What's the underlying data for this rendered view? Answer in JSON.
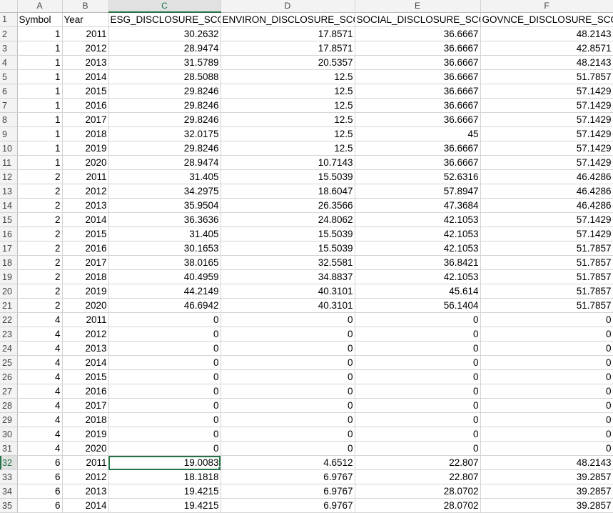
{
  "columns": [
    "A",
    "B",
    "C",
    "D",
    "E",
    "F"
  ],
  "selected_column": "C",
  "selected_row": 32,
  "active_cell": "C32",
  "header_row": [
    "Symbol",
    "Year",
    "ESG_DISCLOSURE_SCORE",
    "ENVIRON_DISCLOSURE_SCORE",
    "SOCIAL_DISCLOSURE_SCORE",
    "GOVNCE_DISCLOSURE_SCORE"
  ],
  "rows": [
    [
      "1",
      "2011",
      "30.2632",
      "17.8571",
      "36.6667",
      "48.2143"
    ],
    [
      "1",
      "2012",
      "28.9474",
      "17.8571",
      "36.6667",
      "42.8571"
    ],
    [
      "1",
      "2013",
      "31.5789",
      "20.5357",
      "36.6667",
      "48.2143"
    ],
    [
      "1",
      "2014",
      "28.5088",
      "12.5",
      "36.6667",
      "51.7857"
    ],
    [
      "1",
      "2015",
      "29.8246",
      "12.5",
      "36.6667",
      "57.1429"
    ],
    [
      "1",
      "2016",
      "29.8246",
      "12.5",
      "36.6667",
      "57.1429"
    ],
    [
      "1",
      "2017",
      "29.8246",
      "12.5",
      "36.6667",
      "57.1429"
    ],
    [
      "1",
      "2018",
      "32.0175",
      "12.5",
      "45",
      "57.1429"
    ],
    [
      "1",
      "2019",
      "29.8246",
      "12.5",
      "36.6667",
      "57.1429"
    ],
    [
      "1",
      "2020",
      "28.9474",
      "10.7143",
      "36.6667",
      "57.1429"
    ],
    [
      "2",
      "2011",
      "31.405",
      "15.5039",
      "52.6316",
      "46.4286"
    ],
    [
      "2",
      "2012",
      "34.2975",
      "18.6047",
      "57.8947",
      "46.4286"
    ],
    [
      "2",
      "2013",
      "35.9504",
      "26.3566",
      "47.3684",
      "46.4286"
    ],
    [
      "2",
      "2014",
      "36.3636",
      "24.8062",
      "42.1053",
      "57.1429"
    ],
    [
      "2",
      "2015",
      "31.405",
      "15.5039",
      "42.1053",
      "57.1429"
    ],
    [
      "2",
      "2016",
      "30.1653",
      "15.5039",
      "42.1053",
      "51.7857"
    ],
    [
      "2",
      "2017",
      "38.0165",
      "32.5581",
      "36.8421",
      "51.7857"
    ],
    [
      "2",
      "2018",
      "40.4959",
      "34.8837",
      "42.1053",
      "51.7857"
    ],
    [
      "2",
      "2019",
      "44.2149",
      "40.3101",
      "45.614",
      "51.7857"
    ],
    [
      "2",
      "2020",
      "46.6942",
      "40.3101",
      "56.1404",
      "51.7857"
    ],
    [
      "4",
      "2011",
      "0",
      "0",
      "0",
      "0"
    ],
    [
      "4",
      "2012",
      "0",
      "0",
      "0",
      "0"
    ],
    [
      "4",
      "2013",
      "0",
      "0",
      "0",
      "0"
    ],
    [
      "4",
      "2014",
      "0",
      "0",
      "0",
      "0"
    ],
    [
      "4",
      "2015",
      "0",
      "0",
      "0",
      "0"
    ],
    [
      "4",
      "2016",
      "0",
      "0",
      "0",
      "0"
    ],
    [
      "4",
      "2017",
      "0",
      "0",
      "0",
      "0"
    ],
    [
      "4",
      "2018",
      "0",
      "0",
      "0",
      "0"
    ],
    [
      "4",
      "2019",
      "0",
      "0",
      "0",
      "0"
    ],
    [
      "4",
      "2020",
      "0",
      "0",
      "0",
      "0"
    ],
    [
      "6",
      "2011",
      "19.0083",
      "4.6512",
      "22.807",
      "48.2143"
    ],
    [
      "6",
      "2012",
      "18.1818",
      "6.9767",
      "22.807",
      "39.2857"
    ],
    [
      "6",
      "2013",
      "19.4215",
      "6.9767",
      "28.0702",
      "39.2857"
    ],
    [
      "6",
      "2014",
      "19.4215",
      "6.9767",
      "28.0702",
      "39.2857"
    ]
  ]
}
